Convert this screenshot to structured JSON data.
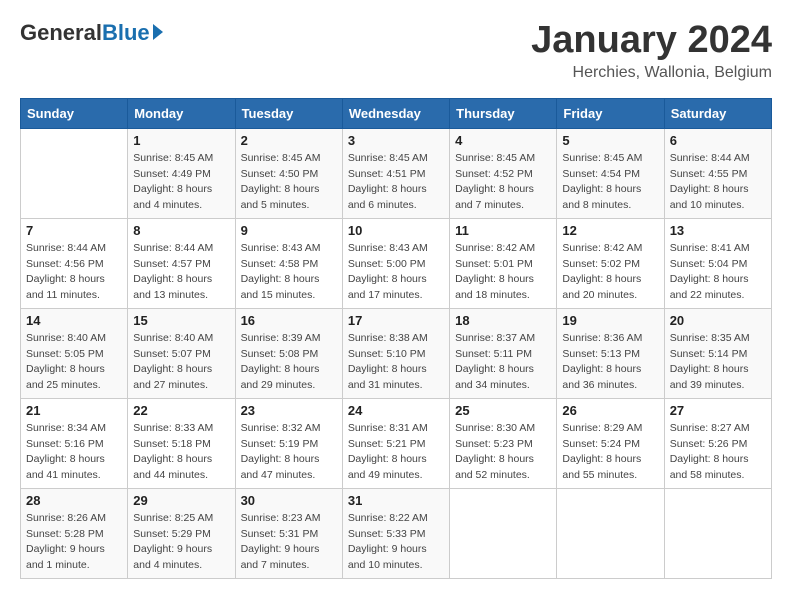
{
  "logo": {
    "general": "General",
    "blue": "Blue"
  },
  "title": "January 2024",
  "location": "Herchies, Wallonia, Belgium",
  "days_of_week": [
    "Sunday",
    "Monday",
    "Tuesday",
    "Wednesday",
    "Thursday",
    "Friday",
    "Saturday"
  ],
  "weeks": [
    [
      {
        "day": "",
        "sunrise": "",
        "sunset": "",
        "daylight": ""
      },
      {
        "day": "1",
        "sunrise": "Sunrise: 8:45 AM",
        "sunset": "Sunset: 4:49 PM",
        "daylight": "Daylight: 8 hours and 4 minutes."
      },
      {
        "day": "2",
        "sunrise": "Sunrise: 8:45 AM",
        "sunset": "Sunset: 4:50 PM",
        "daylight": "Daylight: 8 hours and 5 minutes."
      },
      {
        "day": "3",
        "sunrise": "Sunrise: 8:45 AM",
        "sunset": "Sunset: 4:51 PM",
        "daylight": "Daylight: 8 hours and 6 minutes."
      },
      {
        "day": "4",
        "sunrise": "Sunrise: 8:45 AM",
        "sunset": "Sunset: 4:52 PM",
        "daylight": "Daylight: 8 hours and 7 minutes."
      },
      {
        "day": "5",
        "sunrise": "Sunrise: 8:45 AM",
        "sunset": "Sunset: 4:54 PM",
        "daylight": "Daylight: 8 hours and 8 minutes."
      },
      {
        "day": "6",
        "sunrise": "Sunrise: 8:44 AM",
        "sunset": "Sunset: 4:55 PM",
        "daylight": "Daylight: 8 hours and 10 minutes."
      }
    ],
    [
      {
        "day": "7",
        "sunrise": "Sunrise: 8:44 AM",
        "sunset": "Sunset: 4:56 PM",
        "daylight": "Daylight: 8 hours and 11 minutes."
      },
      {
        "day": "8",
        "sunrise": "Sunrise: 8:44 AM",
        "sunset": "Sunset: 4:57 PM",
        "daylight": "Daylight: 8 hours and 13 minutes."
      },
      {
        "day": "9",
        "sunrise": "Sunrise: 8:43 AM",
        "sunset": "Sunset: 4:58 PM",
        "daylight": "Daylight: 8 hours and 15 minutes."
      },
      {
        "day": "10",
        "sunrise": "Sunrise: 8:43 AM",
        "sunset": "Sunset: 5:00 PM",
        "daylight": "Daylight: 8 hours and 17 minutes."
      },
      {
        "day": "11",
        "sunrise": "Sunrise: 8:42 AM",
        "sunset": "Sunset: 5:01 PM",
        "daylight": "Daylight: 8 hours and 18 minutes."
      },
      {
        "day": "12",
        "sunrise": "Sunrise: 8:42 AM",
        "sunset": "Sunset: 5:02 PM",
        "daylight": "Daylight: 8 hours and 20 minutes."
      },
      {
        "day": "13",
        "sunrise": "Sunrise: 8:41 AM",
        "sunset": "Sunset: 5:04 PM",
        "daylight": "Daylight: 8 hours and 22 minutes."
      }
    ],
    [
      {
        "day": "14",
        "sunrise": "Sunrise: 8:40 AM",
        "sunset": "Sunset: 5:05 PM",
        "daylight": "Daylight: 8 hours and 25 minutes."
      },
      {
        "day": "15",
        "sunrise": "Sunrise: 8:40 AM",
        "sunset": "Sunset: 5:07 PM",
        "daylight": "Daylight: 8 hours and 27 minutes."
      },
      {
        "day": "16",
        "sunrise": "Sunrise: 8:39 AM",
        "sunset": "Sunset: 5:08 PM",
        "daylight": "Daylight: 8 hours and 29 minutes."
      },
      {
        "day": "17",
        "sunrise": "Sunrise: 8:38 AM",
        "sunset": "Sunset: 5:10 PM",
        "daylight": "Daylight: 8 hours and 31 minutes."
      },
      {
        "day": "18",
        "sunrise": "Sunrise: 8:37 AM",
        "sunset": "Sunset: 5:11 PM",
        "daylight": "Daylight: 8 hours and 34 minutes."
      },
      {
        "day": "19",
        "sunrise": "Sunrise: 8:36 AM",
        "sunset": "Sunset: 5:13 PM",
        "daylight": "Daylight: 8 hours and 36 minutes."
      },
      {
        "day": "20",
        "sunrise": "Sunrise: 8:35 AM",
        "sunset": "Sunset: 5:14 PM",
        "daylight": "Daylight: 8 hours and 39 minutes."
      }
    ],
    [
      {
        "day": "21",
        "sunrise": "Sunrise: 8:34 AM",
        "sunset": "Sunset: 5:16 PM",
        "daylight": "Daylight: 8 hours and 41 minutes."
      },
      {
        "day": "22",
        "sunrise": "Sunrise: 8:33 AM",
        "sunset": "Sunset: 5:18 PM",
        "daylight": "Daylight: 8 hours and 44 minutes."
      },
      {
        "day": "23",
        "sunrise": "Sunrise: 8:32 AM",
        "sunset": "Sunset: 5:19 PM",
        "daylight": "Daylight: 8 hours and 47 minutes."
      },
      {
        "day": "24",
        "sunrise": "Sunrise: 8:31 AM",
        "sunset": "Sunset: 5:21 PM",
        "daylight": "Daylight: 8 hours and 49 minutes."
      },
      {
        "day": "25",
        "sunrise": "Sunrise: 8:30 AM",
        "sunset": "Sunset: 5:23 PM",
        "daylight": "Daylight: 8 hours and 52 minutes."
      },
      {
        "day": "26",
        "sunrise": "Sunrise: 8:29 AM",
        "sunset": "Sunset: 5:24 PM",
        "daylight": "Daylight: 8 hours and 55 minutes."
      },
      {
        "day": "27",
        "sunrise": "Sunrise: 8:27 AM",
        "sunset": "Sunset: 5:26 PM",
        "daylight": "Daylight: 8 hours and 58 minutes."
      }
    ],
    [
      {
        "day": "28",
        "sunrise": "Sunrise: 8:26 AM",
        "sunset": "Sunset: 5:28 PM",
        "daylight": "Daylight: 9 hours and 1 minute."
      },
      {
        "day": "29",
        "sunrise": "Sunrise: 8:25 AM",
        "sunset": "Sunset: 5:29 PM",
        "daylight": "Daylight: 9 hours and 4 minutes."
      },
      {
        "day": "30",
        "sunrise": "Sunrise: 8:23 AM",
        "sunset": "Sunset: 5:31 PM",
        "daylight": "Daylight: 9 hours and 7 minutes."
      },
      {
        "day": "31",
        "sunrise": "Sunrise: 8:22 AM",
        "sunset": "Sunset: 5:33 PM",
        "daylight": "Daylight: 9 hours and 10 minutes."
      },
      {
        "day": "",
        "sunrise": "",
        "sunset": "",
        "daylight": ""
      },
      {
        "day": "",
        "sunrise": "",
        "sunset": "",
        "daylight": ""
      },
      {
        "day": "",
        "sunrise": "",
        "sunset": "",
        "daylight": ""
      }
    ]
  ]
}
